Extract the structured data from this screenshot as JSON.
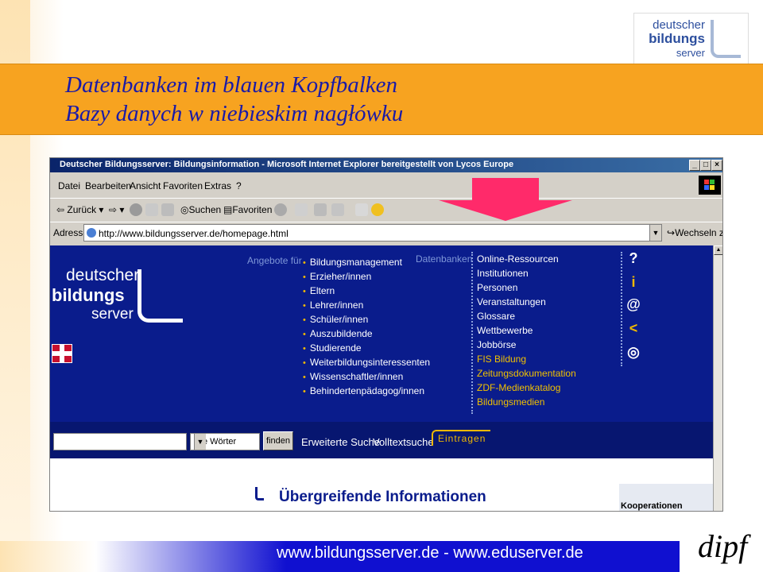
{
  "slide": {
    "title_de": "Datenbanken im blauen Kopfbalken",
    "title_pl": "Bazy danych w niebieskim nagłówku",
    "logo": {
      "line1": "deutscher",
      "line2": "bildungs",
      "line3": "server"
    },
    "footer": "www.bildungsserver.de  -  www.eduserver.de",
    "footer_logo": "dipf",
    "colors": {
      "band": "#f7a320",
      "title": "#1a1aa8",
      "footer": "#1010d0",
      "arrow": "#ff2a6a"
    }
  },
  "browser": {
    "window_title": "Deutscher Bildungsserver: Bildungsinformation - Microsoft Internet Explorer bereitgestellt von Lycos Europe",
    "window_buttons": [
      "_",
      "□",
      "×"
    ],
    "menu": [
      "Datei",
      "Bearbeiten",
      "Ansicht",
      "Favoriten",
      "Extras",
      "?"
    ],
    "toolbar": {
      "back": "Zurück",
      "search": "Suchen",
      "favorites": "Favoriten"
    },
    "address_label": "Adresse",
    "address_url": "http://www.bildungsserver.de/homepage.html",
    "go_label": "Wechseln zu"
  },
  "page": {
    "logo": {
      "line1": "deutscher",
      "line2": "bildungs",
      "line3": "server"
    },
    "angebote_label": "Angebote für",
    "angebote": [
      "Bildungsmanagement",
      "Erzieher/innen",
      "Eltern",
      "Lehrer/innen",
      "Schüler/innen",
      "Auszubildende",
      "Studierende",
      "Weiterbildungsinteressenten",
      "Wissenschaftler/innen",
      "Behindertenpädagog/innen"
    ],
    "datenbanken_label": "Datenbanken",
    "datenbanken": [
      "Online-Ressourcen",
      "Institutionen",
      "Personen",
      "Veranstaltungen",
      "Glossare",
      "Wettbewerbe",
      "Jobbörse"
    ],
    "datenbanken_extra": [
      "FIS Bildung",
      "Zeitungsdokumentation",
      "ZDF-Medienkatalog",
      "Bildungsmedien"
    ],
    "side_icons": [
      "?",
      "i",
      "@",
      "<",
      "◎"
    ],
    "search_select": "alle Wörter",
    "search_button": "finden",
    "erweiterte_suche": "Erweiterte Suche",
    "volltextsuche": "Volltextsuche",
    "eintragen": "Eintragen",
    "subheading": "Übergreifende Informationen",
    "kooperationen": "Kooperationen"
  }
}
